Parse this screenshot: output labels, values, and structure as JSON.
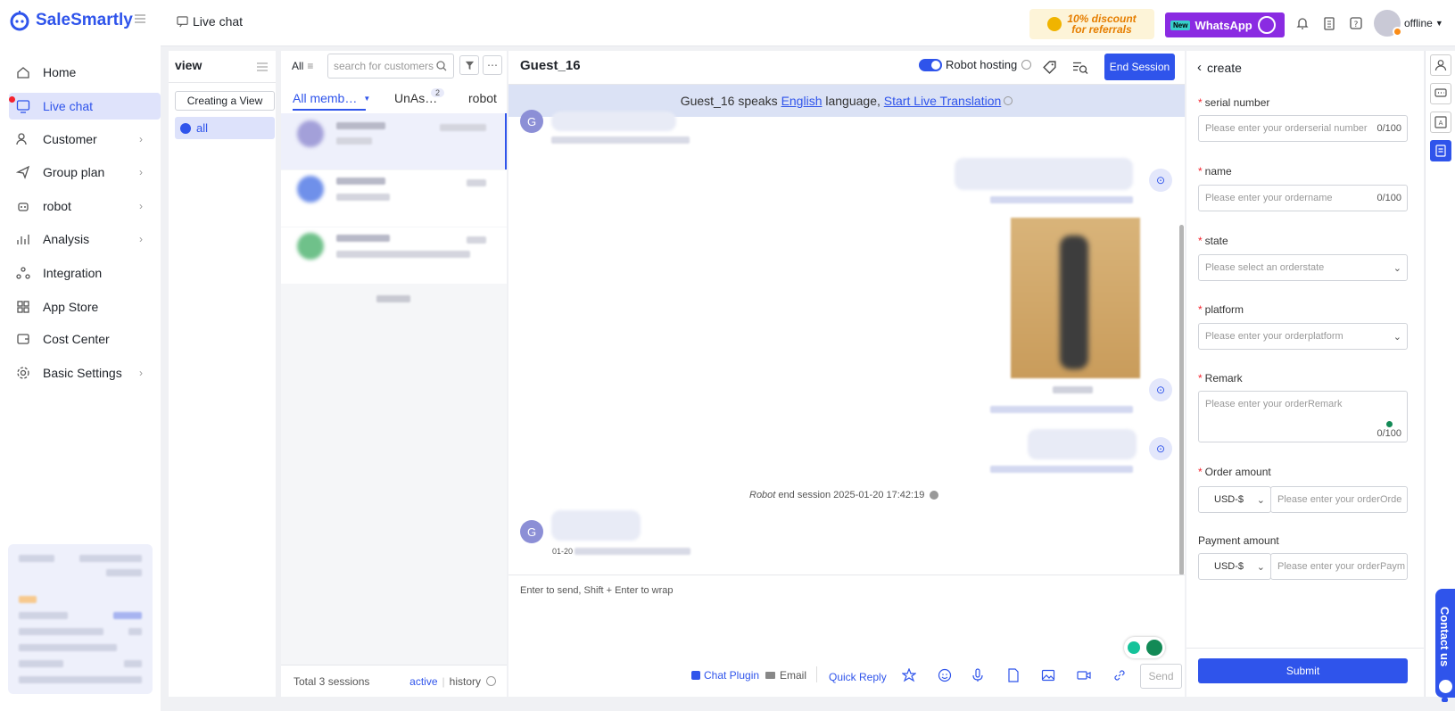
{
  "brand": "SaleSmartly",
  "nav": [
    {
      "label": "Home",
      "chevron": false
    },
    {
      "label": "Live chat",
      "chevron": false
    },
    {
      "label": "Customer",
      "chevron": true
    },
    {
      "label": "Group plan",
      "chevron": true
    },
    {
      "label": "robot",
      "chevron": true
    },
    {
      "label": "Analysis",
      "chevron": true
    },
    {
      "label": "Integration",
      "chevron": false
    },
    {
      "label": "App Store",
      "chevron": false
    },
    {
      "label": "Cost Center",
      "chevron": false
    },
    {
      "label": "Basic Settings",
      "chevron": true
    }
  ],
  "topbar": {
    "breadcrumb": "Live chat",
    "promo_line1": "10% discount",
    "promo_line2": "for referrals",
    "whatsapp_tag": "New",
    "whatsapp_label": "WhatsApp",
    "status": "offline"
  },
  "view_panel": {
    "title": "view",
    "create_label": "Creating a View",
    "all_label": "all"
  },
  "conv_list": {
    "filter_all": "All",
    "search_placeholder": "search for customers",
    "tabs": [
      {
        "label": "All memb…",
        "active": true
      },
      {
        "label": "UnAs…",
        "badge": "2"
      },
      {
        "label": "robot"
      }
    ],
    "total": "Total 3 sessions",
    "active_label": "active",
    "history_label": "history"
  },
  "chat": {
    "title": "Guest_16",
    "robot_hosting": "Robot hosting",
    "end_session": "End Session",
    "trans_guest": "Guest_16",
    "trans_speaks": "speaks",
    "trans_lang": "English",
    "trans_mid": "language,",
    "trans_link": "Start Live Translation",
    "guest_initial": "G",
    "end_notice_robot": "Robot",
    "end_notice_text": "end session 2025-01-20 17:42:19",
    "msg_time_prefix": "01-20",
    "input_placeholder": "Enter to send, Shift + Enter to wrap",
    "chat_plugin": "Chat Plugin",
    "email": "Email",
    "quick_reply": "Quick Reply",
    "send": "Send"
  },
  "form": {
    "back_label": "create",
    "fields": [
      {
        "label": "serial number",
        "placeholder": "Please enter your orderserial number",
        "count": "0/100"
      },
      {
        "label": "name",
        "placeholder": "Please enter your ordername",
        "count": "0/100"
      },
      {
        "label": "state",
        "placeholder": "Please select an orderstate"
      },
      {
        "label": "platform",
        "placeholder": "Please enter your orderplatform"
      },
      {
        "label": "Remark",
        "placeholder": "Please enter your orderRemark",
        "count": "0/100"
      }
    ],
    "order_amount_label": "Order amount",
    "order_amount_currency": "USD-$",
    "order_amount_placeholder": "Please enter your orderOrde",
    "payment_amount_label": "Payment amount",
    "payment_amount_currency": "USD-$",
    "payment_amount_placeholder": "Please enter your orderPaym",
    "submit": "Submit"
  },
  "contact_tab": "Contact us"
}
